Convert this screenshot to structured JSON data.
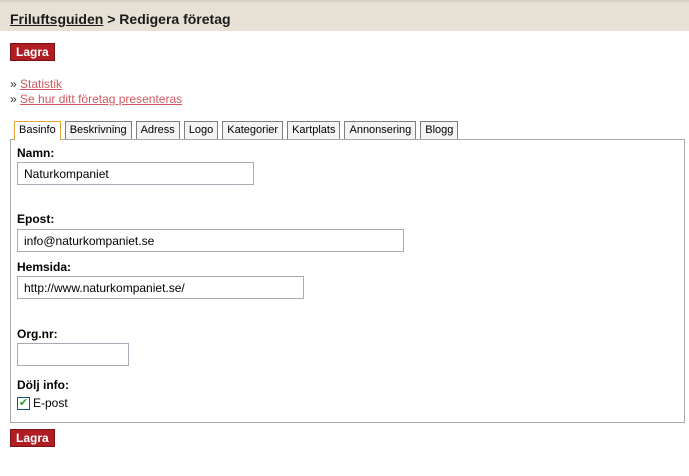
{
  "header": {
    "crumb_link": "Friluftsguiden",
    "separator": " > ",
    "title": "Redigera företag"
  },
  "buttons": {
    "save_top": "Lagra",
    "save_bottom": "Lagra"
  },
  "links": {
    "bullet": "»",
    "items": [
      "Statistik",
      "Se hur ditt företag presenteras"
    ]
  },
  "tabs": [
    "Basinfo",
    "Beskrivning",
    "Adress",
    "Logo",
    "Kategorier",
    "Kartplats",
    "Annonsering",
    "Blogg"
  ],
  "active_tab": "Basinfo",
  "form": {
    "name_label": "Namn:",
    "name_value": "Naturkompaniet",
    "email_label": "Epost:",
    "email_value": "info@naturkompaniet.se",
    "website_label": "Hemsida:",
    "website_value": "http://www.naturkompaniet.se/",
    "orgnr_label": "Org.nr:",
    "orgnr_value": "",
    "hide_label": "Dölj info:",
    "hide_email_label": "E-post",
    "hide_email_checked": true
  },
  "colors": {
    "header_bg": "#e6e1d4",
    "button_bg": "#b01e23",
    "link": "#d2585f",
    "active_tab_border": "#e3a23a"
  }
}
